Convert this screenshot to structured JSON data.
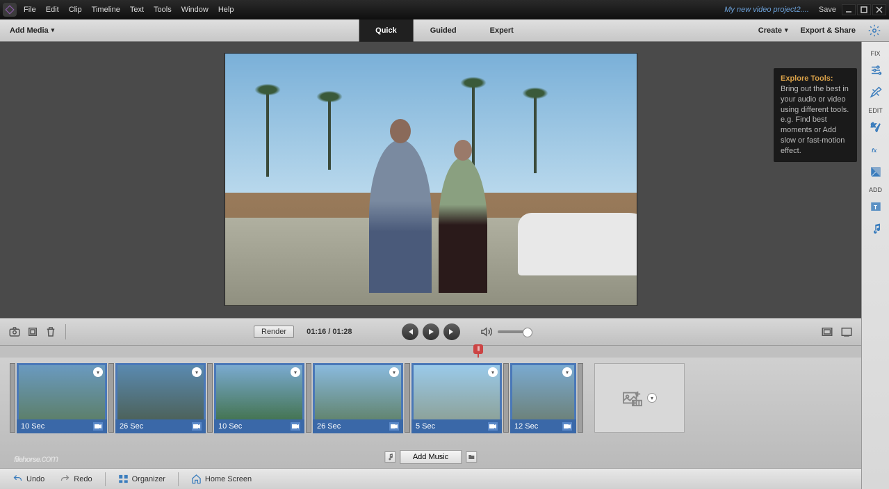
{
  "titlebar": {
    "menus": [
      "File",
      "Edit",
      "Clip",
      "Timeline",
      "Text",
      "Tools",
      "Window",
      "Help"
    ],
    "project_name": "My new video project2....",
    "save": "Save"
  },
  "toolbar": {
    "add_media": "Add Media",
    "modes": [
      "Quick",
      "Guided",
      "Expert"
    ],
    "active_mode": "Quick",
    "create": "Create",
    "export": "Export & Share"
  },
  "controls": {
    "render": "Render",
    "timecode": "01:16 / 01:28"
  },
  "timeline": {
    "clips": [
      {
        "duration": "10 Sec"
      },
      {
        "duration": "26 Sec"
      },
      {
        "duration": "10 Sec"
      },
      {
        "duration": "26 Sec"
      },
      {
        "duration": "5 Sec"
      },
      {
        "duration": "12 Sec"
      }
    ],
    "add_music": "Add Music"
  },
  "bottom": {
    "undo": "Undo",
    "redo": "Redo",
    "organizer": "Organizer",
    "home": "Home Screen"
  },
  "sidepanel": {
    "fix": "FIX",
    "edit": "EDIT",
    "add": "ADD"
  },
  "tooltip": {
    "title": "Explore Tools:",
    "body": "Bring out the best in your audio or video using different tools. e.g. Find best moments or Add slow or fast-motion effect."
  },
  "watermark": {
    "text": "filehorse",
    "suffix": ".com"
  }
}
